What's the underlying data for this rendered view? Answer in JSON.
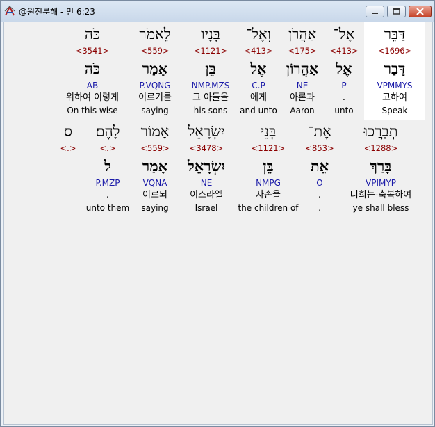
{
  "window": {
    "title": "@원전분해 - 민 6:23",
    "controls": {
      "minimize": "",
      "maximize": "",
      "close": ""
    }
  },
  "rows": [
    {
      "words": [
        {
          "hebrew": "דַּבֵּר",
          "strong": "<1696>",
          "lemma": "דָּבַר",
          "morph": "VPMMYS",
          "korean": "고하여",
          "english": "Speak",
          "highlighted": true
        },
        {
          "hebrew": "אֶל־",
          "strong": "<413>",
          "lemma": "אֶל",
          "morph": "P",
          "korean": ".",
          "english": "unto"
        },
        {
          "hebrew": "אַהֲרֹן",
          "strong": "<175>",
          "lemma": "אַהֲרוֹן",
          "morph": "NE",
          "korean": "아론과",
          "english": "Aaron"
        },
        {
          "hebrew": "וְאֶל־",
          "strong": "<413>",
          "lemma": "אֶל",
          "morph": "C.P",
          "korean": "에게",
          "english": "and unto"
        },
        {
          "hebrew": "בָּנָיו",
          "strong": "<1121>",
          "lemma": "בֵּן",
          "morph": "NMP.MZS",
          "korean": "그 아들을",
          "english": "his sons"
        },
        {
          "hebrew": "לֵאמֹר",
          "strong": "<559>",
          "lemma": "אָמַר",
          "morph": "P.VQNG",
          "korean": "이르기를",
          "english": "saying"
        },
        {
          "hebrew": "כֹּה",
          "strong": "<3541>",
          "lemma": "כֹּה",
          "morph": "AB",
          "korean": "위하여 이렇게",
          "english": "On this wise"
        }
      ]
    },
    {
      "words": [
        {
          "hebrew": "תְבָרֲכוּ",
          "strong": "<1288>",
          "lemma": "בָּרַךְ",
          "morph": "VPIMYP",
          "korean": "너희는-축복하여",
          "english": "ye shall bless"
        },
        {
          "hebrew": "אֶת־",
          "strong": "<853>",
          "lemma": "אֵת",
          "morph": "O",
          "korean": ".",
          "english": "."
        },
        {
          "hebrew": "בְּנֵי",
          "strong": "<1121>",
          "lemma": "בֵּן",
          "morph": "NMPG",
          "korean": "자손을",
          "english": "the children of"
        },
        {
          "hebrew": "יִשְׂרָאֵל",
          "strong": "<3478>",
          "lemma": "יִשְׂרָאֵל",
          "morph": "NE",
          "korean": "이스라엘",
          "english": "Israel"
        },
        {
          "hebrew": "אָמוֹר",
          "strong": "<559>",
          "lemma": "אָמַר",
          "morph": "VQNA",
          "korean": "이르되",
          "english": "saying"
        },
        {
          "hebrew": "לָהֶם׃",
          "strong": "<.>",
          "lemma": "ל",
          "morph": "P.MZP",
          "korean": ".",
          "english": "unto them"
        },
        {
          "hebrew": "ס",
          "strong": "<.>",
          "lemma": "",
          "morph": "",
          "korean": "",
          "english": ""
        }
      ]
    }
  ]
}
